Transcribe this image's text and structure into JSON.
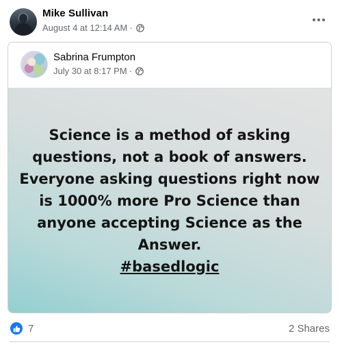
{
  "post": {
    "author": "Mike Sullivan",
    "timestamp": "August 4 at 12:14 AM",
    "separator": "·",
    "privacy_icon": "globe-icon",
    "more_icon": "more-options-icon"
  },
  "shared": {
    "author": "Sabrina Frumpton",
    "timestamp": "July 30 at 8:17 PM",
    "separator": "·",
    "privacy_icon": "globe-icon",
    "quote": "Science is a method of asking questions, not a book of answers. Everyone asking questions right now is 1000% more Pro Science than anyone accepting Science as the Answer.",
    "hashtag": "#basedlogic",
    "background_colors": [
      "#e3e3e3",
      "#93cfd0"
    ]
  },
  "footer": {
    "reaction_icon": "like-icon",
    "like_count": "7",
    "shares": "2 Shares",
    "accent_color": "#1877f2"
  }
}
